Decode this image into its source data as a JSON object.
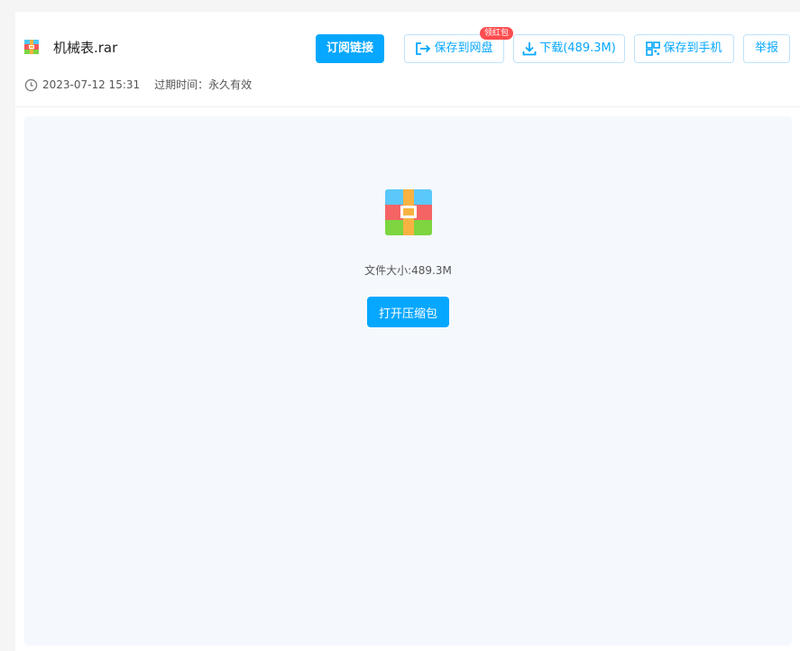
{
  "file": {
    "name": "机械表.rar",
    "icon": "rar-archive-icon"
  },
  "meta": {
    "date": "2023-07-12 15:31",
    "expire_label": "过期时间：永久有效"
  },
  "actions": {
    "subscribe": "订阅链接",
    "save_cloud": "保存到网盘",
    "save_cloud_badge": "领红包",
    "download": "下载(489.3M)",
    "save_phone": "保存到手机",
    "report": "举报"
  },
  "preview": {
    "size_text": "文件大小:489.3M",
    "open_button": "打开压缩包"
  },
  "colors": {
    "accent": "#06a7ff",
    "badge": "#ff4d4f",
    "preview_bg": "#f5f8fd"
  }
}
